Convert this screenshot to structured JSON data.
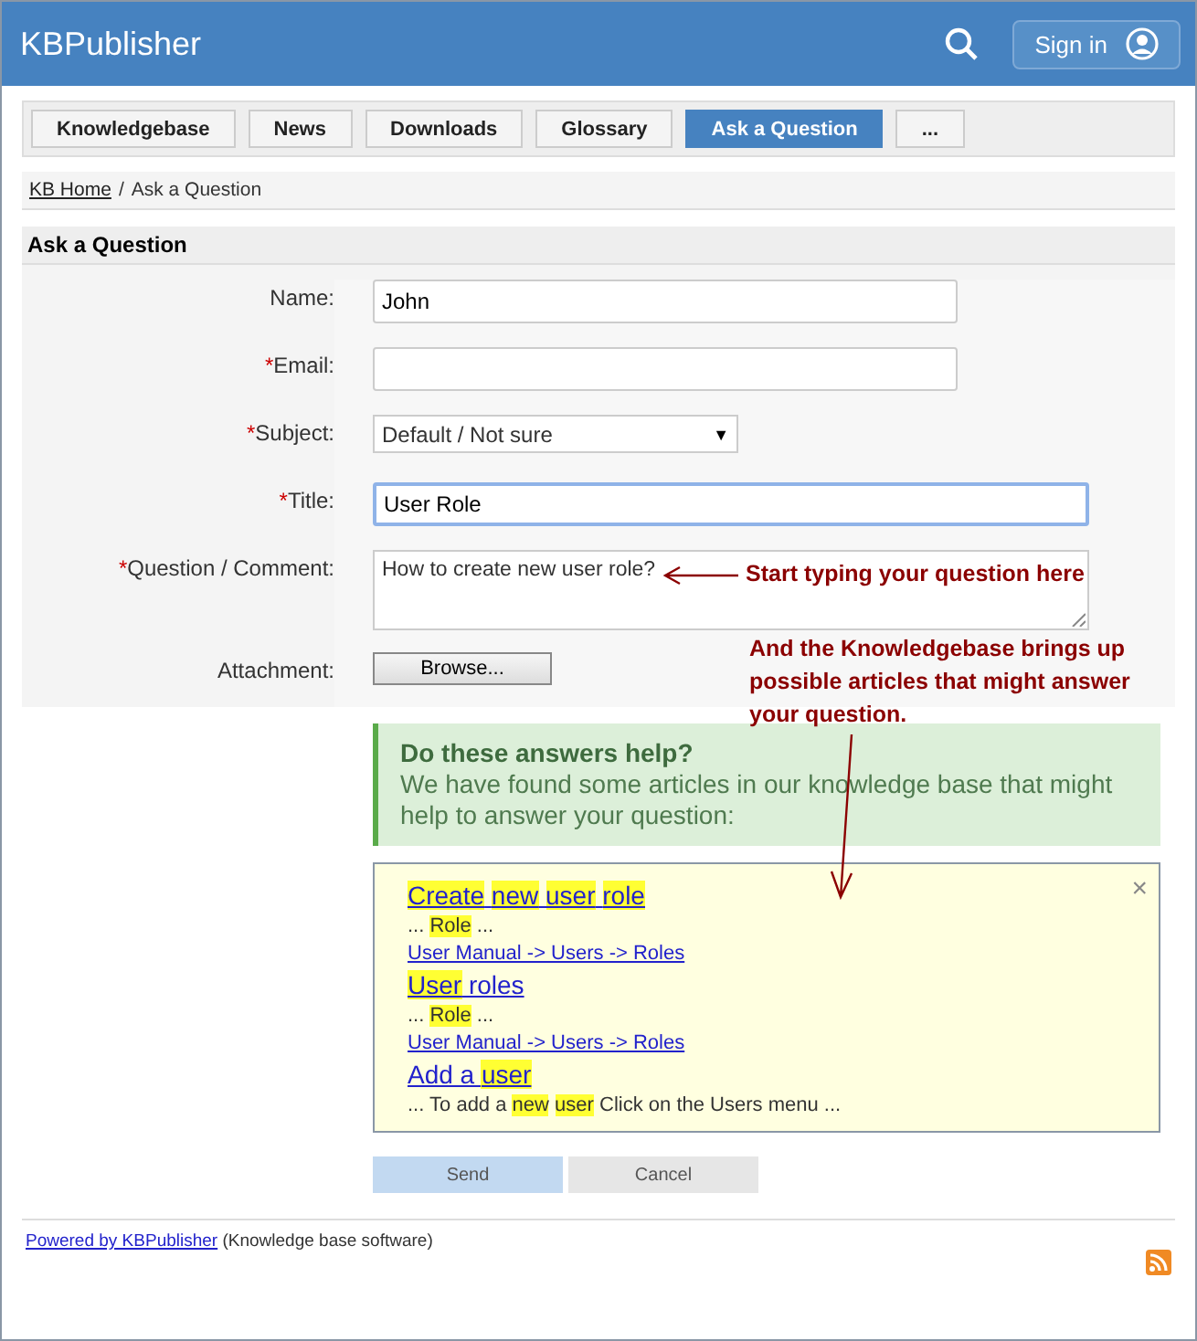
{
  "header": {
    "logo": "KBPublisher",
    "sign_in": "Sign in"
  },
  "nav": [
    {
      "label": "Knowledgebase",
      "selected": false
    },
    {
      "label": "News",
      "selected": false
    },
    {
      "label": "Downloads",
      "selected": false
    },
    {
      "label": "Glossary",
      "selected": false
    },
    {
      "label": "Ask a Question",
      "selected": true
    },
    {
      "label": "...",
      "selected": false
    }
  ],
  "breadcrumb": {
    "link": "KB Home",
    "separator": "/",
    "current": "Ask a Question"
  },
  "section_title": "Ask a Question",
  "form": [
    {
      "label": "Name:",
      "kind": "text",
      "value": "John"
    },
    {
      "label": "Email:",
      "marker": "*",
      "kind": "text"
    },
    {
      "label": "Subject:",
      "marker": "*",
      "kind": "select",
      "value": "Default / Not sure",
      "arrow": "▼"
    },
    {
      "label": "Title:",
      "marker": "*",
      "kind": "text",
      "value": "User Role",
      "focused": true
    },
    {
      "label": "Question / Comment:",
      "marker": "*",
      "kind": "textarea",
      "value": "How to create new user role?"
    },
    {
      "label": "Attachment:",
      "kind": "file",
      "button": "Browse..."
    }
  ],
  "help": {
    "title": "Do these answers help?",
    "text": "We have found some articles in our knowledge base that might help to answer your question:"
  },
  "suggestions": [
    {
      "title": "**Create** **new** **user** **role**",
      "excerpt": "... **Role** ...",
      "path": "User Manual -> Users -> Roles"
    },
    {
      "title": "**User** roles",
      "excerpt": "... **Role** ...",
      "path": "User Manual -> Users -> Roles"
    },
    {
      "title": "Add a **user**",
      "excerpt": "... To add a **new** **user** Click on the Users menu ..."
    }
  ],
  "close": "×",
  "buttons": {
    "send": "Send",
    "cancel": "Cancel"
  },
  "annotations": [
    "Start typing your question here",
    "And the Knowledgebase brings up possible articles that might answer your question."
  ],
  "footer": {
    "link": "Powered by KBPublisher",
    "text": "(Knowledge base software)"
  }
}
